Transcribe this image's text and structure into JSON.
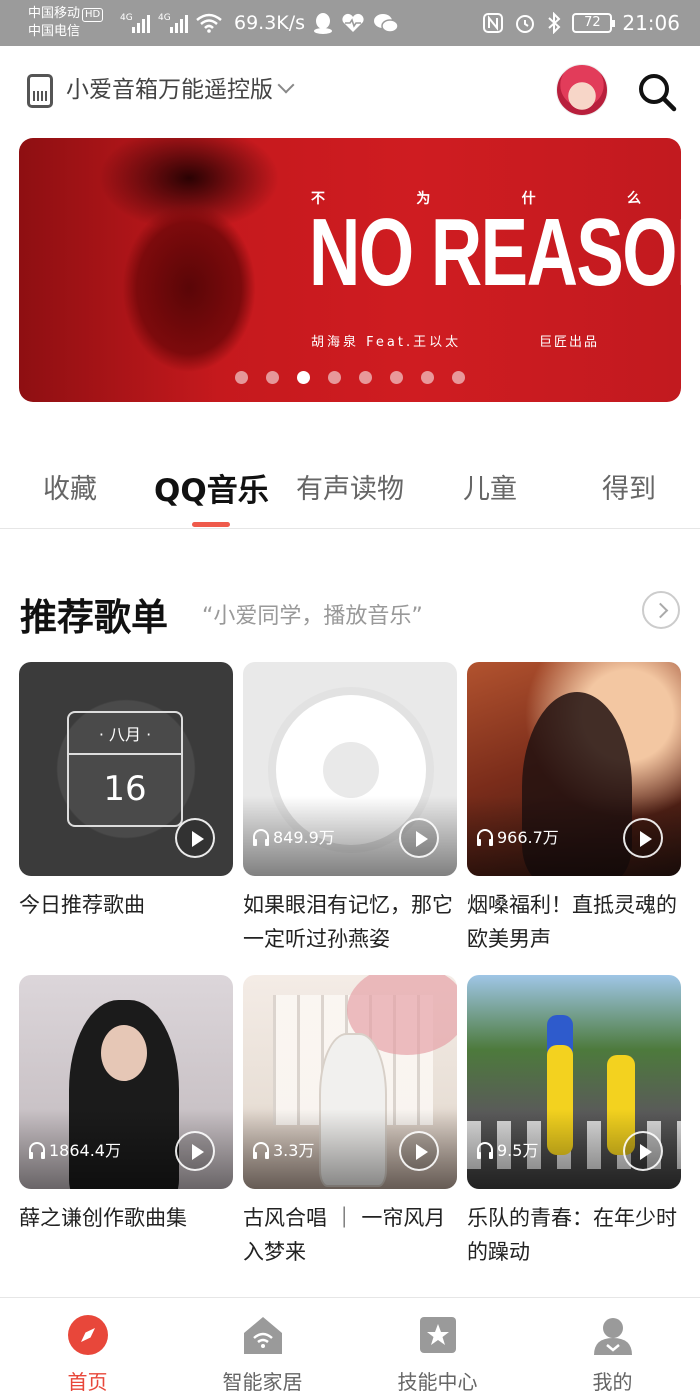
{
  "status_bar": {
    "carrier_1": "中国移动",
    "carrier_1_badge": "HD",
    "carrier_2": "中国电信",
    "network_1": "4G",
    "network_2": "4G",
    "speed": "69.3K/s",
    "battery": "72",
    "time": "21:06"
  },
  "header": {
    "device_title": "小爱音箱万能遥控版"
  },
  "banner": {
    "subtitle_chars": [
      "不",
      "为",
      "什",
      "么"
    ],
    "title": "NO REASON",
    "credit": "胡海泉  Feat.王以太",
    "credit_right": "巨匠出品",
    "page_count": 8,
    "active_page_index": 2
  },
  "tabs": [
    {
      "label": "收藏"
    },
    {
      "label": "QQ音乐"
    },
    {
      "label": "有声读物"
    },
    {
      "label": "儿童"
    },
    {
      "label": "得到"
    }
  ],
  "active_tab_index": 1,
  "section": {
    "title": "推荐歌单",
    "subtitle": "“小爱同学，播放音乐”"
  },
  "playlists": [
    {
      "title": "今日推荐歌曲",
      "plays": "",
      "cover": "calendar",
      "cal_month": "· 八月 ·",
      "cal_day": "16"
    },
    {
      "title": "如果眼泪有记忆，那它一定听过孙燕姿",
      "plays": "849.9万",
      "cover": "disc"
    },
    {
      "title": "烟嗓福利！直抵灵魂的欧美男声",
      "plays": "966.7万",
      "cover": "smoke"
    },
    {
      "title": "薛之谦创作歌曲集",
      "plays": "1864.4万",
      "cover": "singer"
    },
    {
      "title": "古风合唱 ｜ 一帘风月入梦来",
      "plays": "3.3万",
      "cover": "guzhuang"
    },
    {
      "title": "乐队的青春：在年少时的躁动",
      "plays": "9.5万",
      "cover": "simpsons"
    }
  ],
  "bottom_nav": [
    {
      "label": "首页",
      "icon": "compass-icon",
      "active": true
    },
    {
      "label": "智能家居",
      "icon": "home-wifi-icon",
      "active": false
    },
    {
      "label": "技能中心",
      "icon": "star-icon",
      "active": false
    },
    {
      "label": "我的",
      "icon": "user-icon",
      "active": false
    }
  ],
  "colors": {
    "accent": "#e8473a",
    "banner_red": "#cf1c21",
    "status_bar": "#9b9b9b"
  }
}
